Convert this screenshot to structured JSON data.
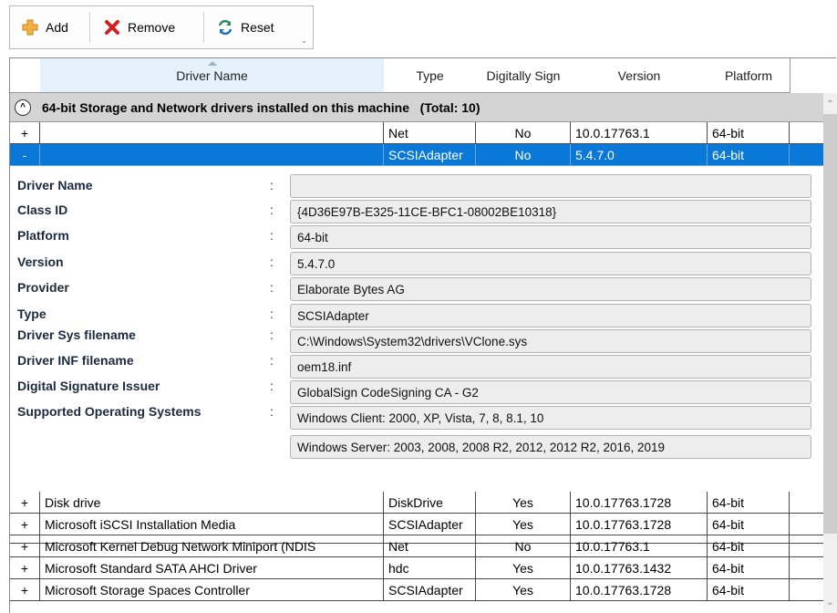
{
  "toolbar": {
    "add_label": "Add",
    "remove_label": "Remove",
    "reset_label": "Reset"
  },
  "columns": [
    "Driver Name",
    "Type",
    "Digitally Sign",
    "Version",
    "Platform"
  ],
  "group": {
    "title": "64-bit Storage and Network drivers installed on this machine   (Total: 10)"
  },
  "top_rows": [
    {
      "toggle": "+",
      "name": "",
      "type": "Net",
      "signed": "No",
      "version": "10.0.17763.1",
      "platform": "64-bit"
    },
    {
      "toggle": "-",
      "name": "",
      "type": "SCSIAdapter",
      "signed": "No",
      "version": "5.4.7.0",
      "platform": "64-bit"
    }
  ],
  "detail": {
    "fields": [
      {
        "label": "Driver Name",
        "value": ""
      },
      {
        "label": "Class ID",
        "value": "{4D36E97B-E325-11CE-BFC1-08002BE10318}"
      },
      {
        "label": "Platform",
        "value": "64-bit"
      },
      {
        "label": "Version",
        "value": "5.4.7.0"
      },
      {
        "label": "Provider",
        "value": "Elaborate Bytes AG"
      },
      {
        "label": "Type",
        "value": "SCSIAdapter"
      },
      {
        "label": "Driver Sys filename",
        "value": "C:\\Windows\\System32\\drivers\\VClone.sys"
      },
      {
        "label": "Driver INF filename",
        "value": "oem18.inf"
      },
      {
        "label": "Digital Signature Issuer",
        "value": "GlobalSign CodeSigning CA - G2"
      },
      {
        "label": "Supported Operating Systems",
        "value": "Windows Client: 2000, XP, Vista, 7, 8, 8.1, 10"
      }
    ],
    "os_server": "Windows Server: 2003, 2008, 2008 R2, 2012, 2012 R2, 2016, 2019",
    "colon": ":"
  },
  "bottom_rows": [
    {
      "toggle": "+",
      "name": "Disk drive",
      "type": "DiskDrive",
      "signed": "Yes",
      "version": "10.0.17763.1728",
      "platform": "64-bit"
    },
    {
      "toggle": "+",
      "name": "Microsoft iSCSI Installation Media",
      "type": "SCSIAdapter",
      "signed": "Yes",
      "version": "10.0.17763.1728",
      "platform": "64-bit"
    },
    {
      "toggle": "+",
      "name": "Microsoft Kernel Debug Network Miniport (NDIS",
      "type": "Net",
      "signed": "No",
      "version": "10.0.17763.1",
      "platform": "64-bit"
    },
    {
      "toggle": "+",
      "name": "Microsoft Standard SATA AHCI Driver",
      "type": "hdc",
      "signed": "Yes",
      "version": "10.0.17763.1432",
      "platform": "64-bit"
    },
    {
      "toggle": "+",
      "name": "Microsoft Storage Spaces Controller",
      "type": "SCSIAdapter",
      "signed": "Yes",
      "version": "10.0.17763.1728",
      "platform": "64-bit"
    }
  ],
  "colors": {
    "selection": "#0a78d7",
    "group_bg": "#d4d4d4",
    "add_icon": "#f0a020",
    "remove_icon": "#d42020",
    "reset_icon": "#2e8b57"
  }
}
